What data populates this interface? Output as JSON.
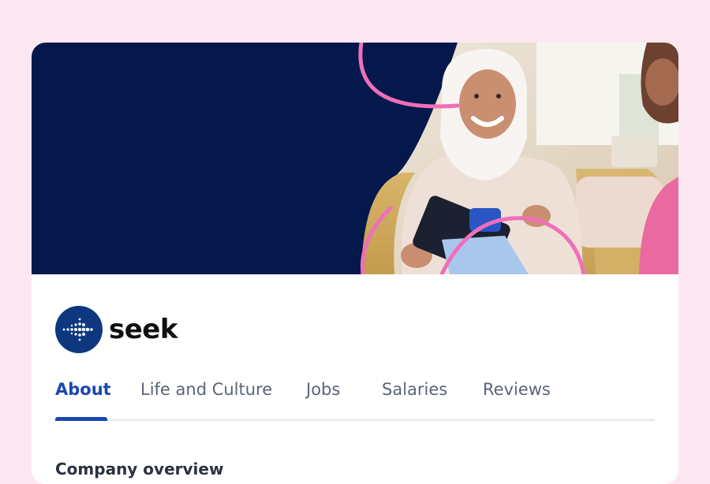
{
  "brand": {
    "name": "seek",
    "logo_color": "#0d3880"
  },
  "banner": {
    "background_color": "#05184c",
    "accent_color": "#ef6fb8",
    "image": "woman-in-hijab-smiling-photo"
  },
  "tabs": [
    {
      "label": "About",
      "active": true
    },
    {
      "label": "Life and Culture",
      "active": false
    },
    {
      "label": "Jobs",
      "active": false
    },
    {
      "label": "Salaries",
      "active": false
    },
    {
      "label": "Reviews",
      "active": false
    }
  ],
  "content": {
    "section_title": "Company overview"
  },
  "colors": {
    "page_background": "#fce6f2",
    "active_tab": "#1b47b0",
    "inactive_tab": "#5a6477"
  }
}
